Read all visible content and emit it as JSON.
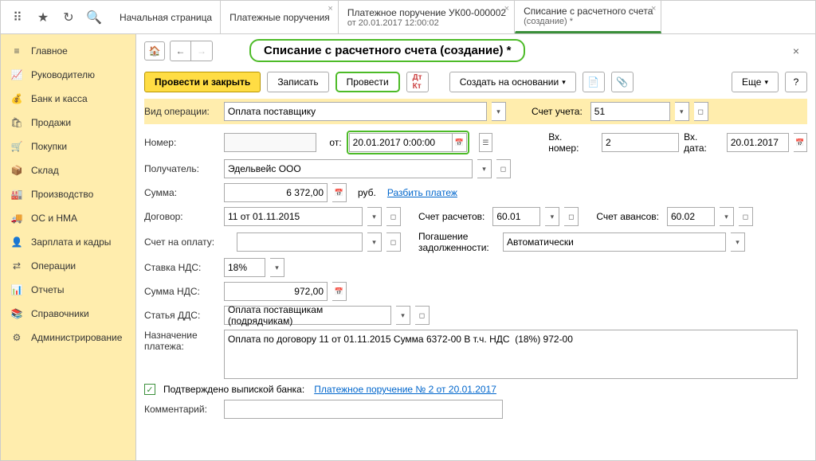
{
  "tabs": [
    {
      "title": "Начальная страница",
      "sub": ""
    },
    {
      "title": "Платежные поручения",
      "sub": ""
    },
    {
      "title": "Платежное поручение УК00-000002",
      "sub": "от 20.01.2017 12:00:02"
    },
    {
      "title": "Списание с расчетного счета",
      "sub": "(создание) *"
    }
  ],
  "sidebar": [
    {
      "label": "Главное",
      "icon": "≡"
    },
    {
      "label": "Руководителю",
      "icon": "📈"
    },
    {
      "label": "Банк и касса",
      "icon": "💰"
    },
    {
      "label": "Продажи",
      "icon": "🛍"
    },
    {
      "label": "Покупки",
      "icon": "🛒"
    },
    {
      "label": "Склад",
      "icon": "📦"
    },
    {
      "label": "Производство",
      "icon": "🏭"
    },
    {
      "label": "ОС и НМА",
      "icon": "🚚"
    },
    {
      "label": "Зарплата и кадры",
      "icon": "👤"
    },
    {
      "label": "Операции",
      "icon": "⇄"
    },
    {
      "label": "Отчеты",
      "icon": "📊"
    },
    {
      "label": "Справочники",
      "icon": "📚"
    },
    {
      "label": "Администрирование",
      "icon": "⚙"
    }
  ],
  "page_title": "Списание с расчетного счета (создание) *",
  "toolbar": {
    "post_close": "Провести и закрыть",
    "save": "Записать",
    "post": "Провести",
    "create_based": "Создать на основании",
    "more": "Еще"
  },
  "form": {
    "op_type_label": "Вид операции:",
    "op_type": "Оплата поставщику",
    "account_label": "Счет учета:",
    "account": "51",
    "number_label": "Номер:",
    "number": "",
    "from_label": "от:",
    "date": "20.01.2017  0:00:00",
    "in_number_label": "Вх. номер:",
    "in_number": "2",
    "in_date_label": "Вх. дата:",
    "in_date": "20.01.2017",
    "recipient_label": "Получатель:",
    "recipient": "Эдельвейс ООО",
    "sum_label": "Сумма:",
    "sum": "6 372,00",
    "currency": "руб.",
    "split_link": "Разбить платеж",
    "contract_label": "Договор:",
    "contract": "11 от 01.11.2015",
    "settlement_label": "Счет расчетов:",
    "settlement": "60.01",
    "advance_label": "Счет авансов:",
    "advance": "60.02",
    "invoice_label": "Счет на оплату:",
    "invoice": "",
    "debt_label": "Погашение задолженности:",
    "debt": "Автоматически",
    "vat_rate_label": "Ставка НДС:",
    "vat_rate": "18%",
    "vat_sum_label": "Сумма НДС:",
    "vat_sum": "972,00",
    "dds_label": "Статья ДДС:",
    "dds": "Оплата поставщикам (подрядчикам)",
    "purpose_label": "Назначение платежа:",
    "purpose": "Оплата по договору 11 от 01.11.2015 Сумма 6372-00 В т.ч. НДС  (18%) 972-00",
    "confirmed_label": "Подтверждено выпиской банка:",
    "confirmed_link": "Платежное поручение № 2 от 20.01.2017",
    "comment_label": "Комментарий:",
    "comment": ""
  }
}
